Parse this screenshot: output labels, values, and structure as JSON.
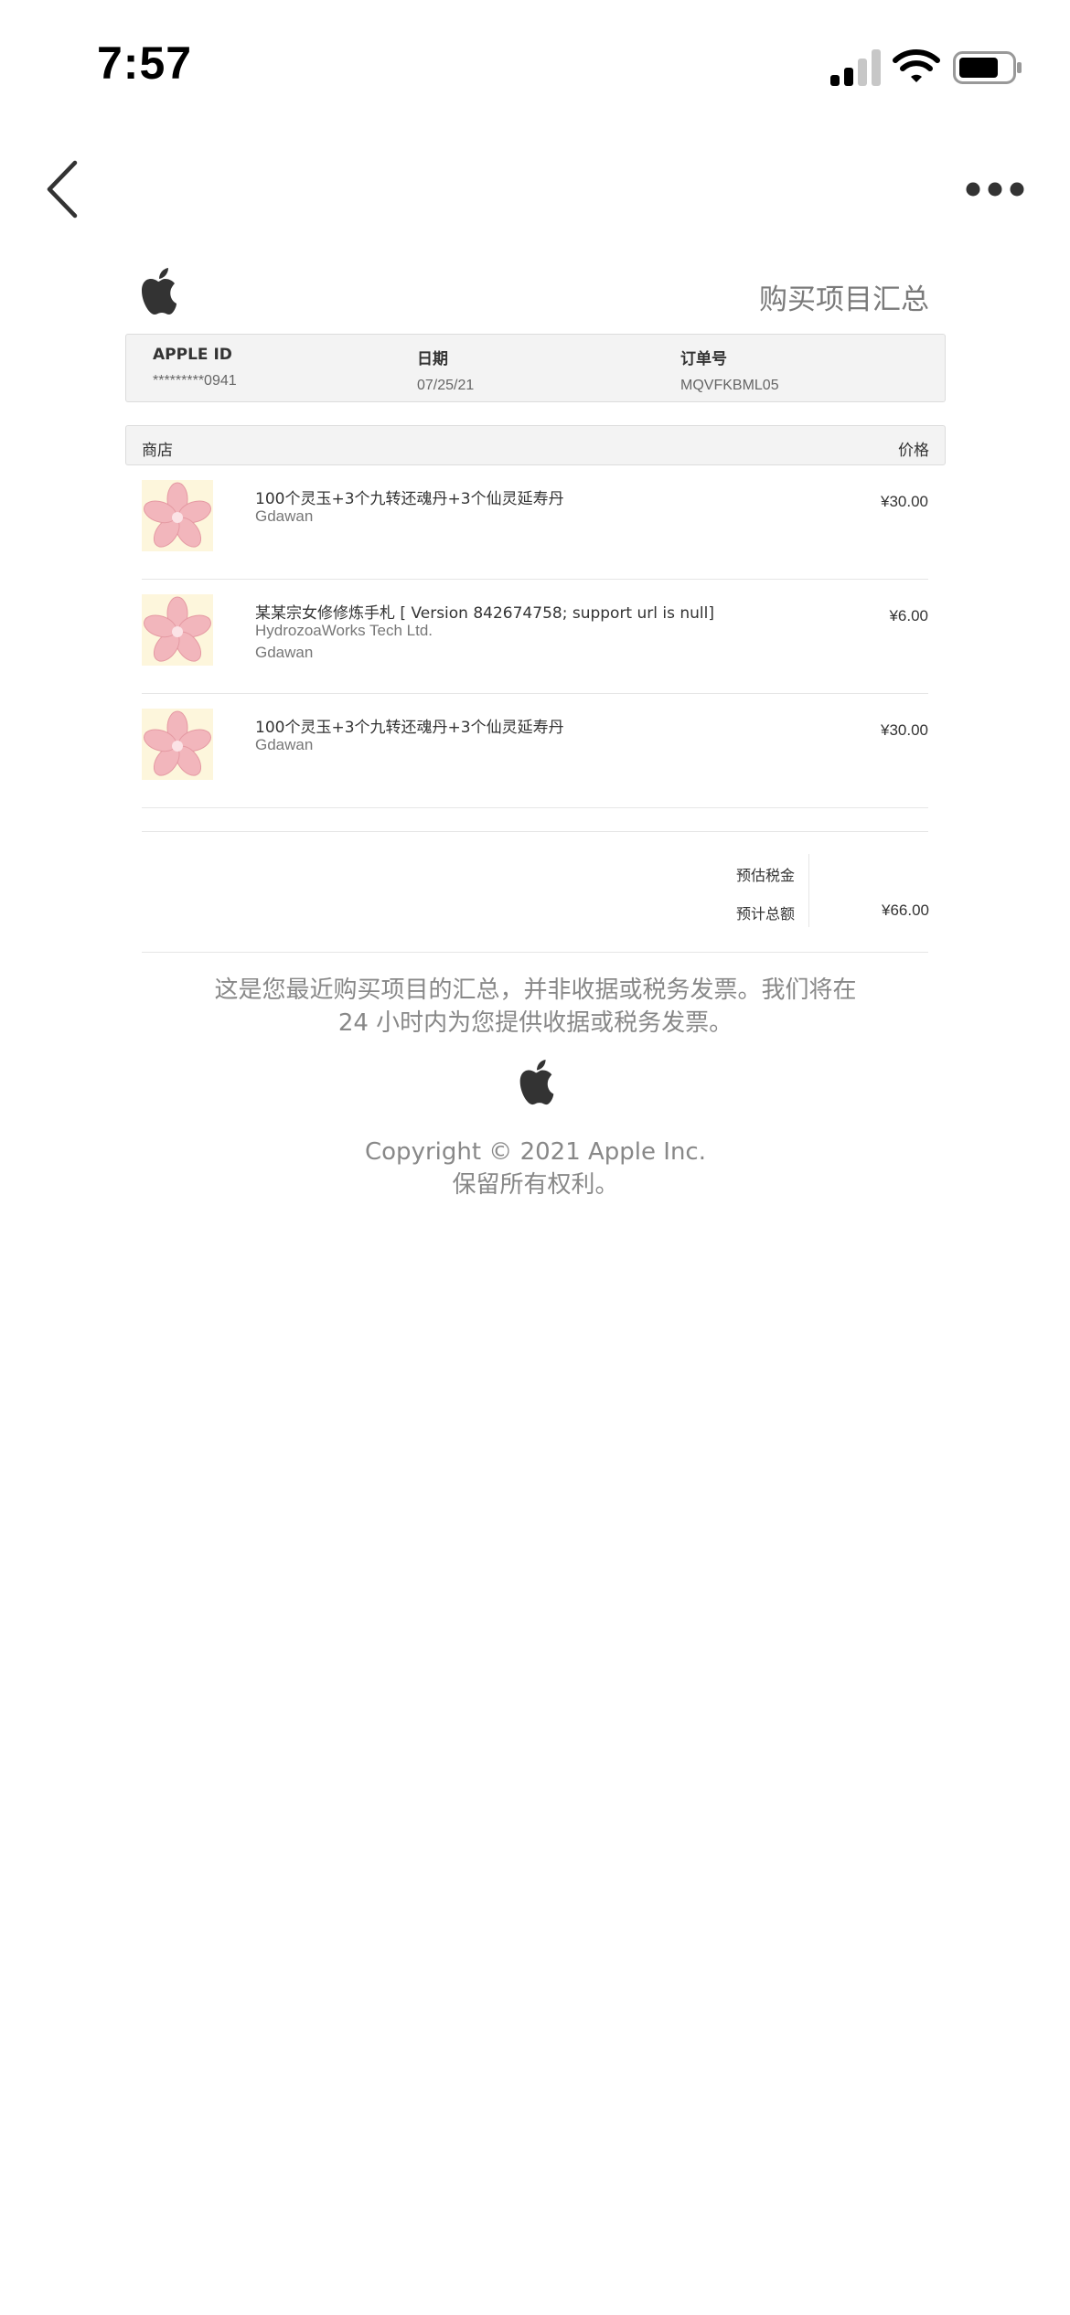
{
  "status_bar": {
    "time": "7:57"
  },
  "receipt": {
    "title": "购买项目汇总",
    "info": [
      {
        "label": "APPLE ID",
        "value": "*********0941"
      },
      {
        "label": "日期",
        "value": "07/25/21"
      },
      {
        "label": "订单号",
        "value": "MQVFKBML05"
      }
    ],
    "table_header": {
      "store": "商店",
      "price": "价格"
    },
    "items": [
      {
        "name": "100个灵玉+3个九转还魂丹+3个仙灵延寿丹",
        "sub1": "Gdawan",
        "sub2": "",
        "price": "¥30.00"
      },
      {
        "name": "某某宗女修修炼手札 [ Version 842674758; support url is null]",
        "sub1": "HydrozoaWorks Tech Ltd.",
        "sub2": "Gdawan",
        "price": "¥6.00"
      },
      {
        "name": "100个灵玉+3个九转还魂丹+3个仙灵延寿丹",
        "sub1": "Gdawan",
        "sub2": "",
        "price": "¥30.00"
      }
    ],
    "totals": {
      "tax_label": "预估税金",
      "tax_value": "",
      "total_label": "预计总额",
      "total_value": "¥66.00"
    },
    "footer_note_line1": "这是您最近购买项目的汇总，并非收据或税务发票。我们将在",
    "footer_note_line2": "24 小时内为您提供收据或税务发票。",
    "copyright_line1": "Copyright © 2021 Apple Inc.",
    "copyright_line2": "保留所有权利。"
  },
  "icons": {
    "back": "chevron-left-icon",
    "more": "more-icon",
    "logo": "apple-logo-icon",
    "item_image": "sakura-flower-icon"
  },
  "colors": {
    "petal": "#f2b6bc",
    "item_bg": "#fdf6dc",
    "header_bg": "#f3f3f3"
  }
}
